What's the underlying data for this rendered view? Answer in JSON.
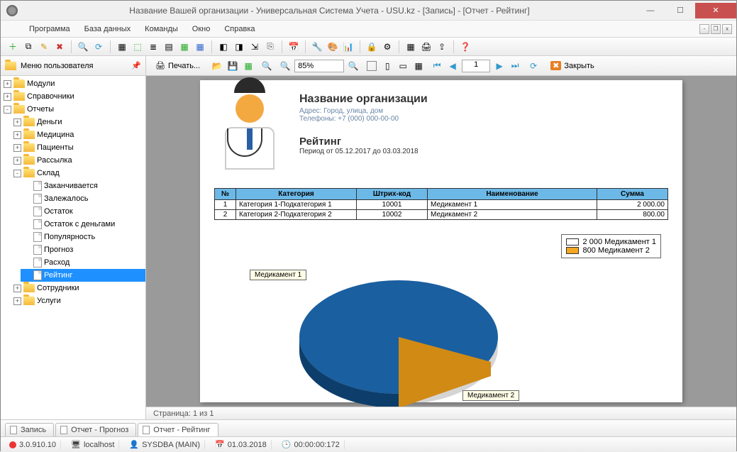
{
  "window": {
    "title": "Название Вашей организации - Универсальная Система Учета - USU.kz - [Запись] - [Отчет - Рейтинг]"
  },
  "menu": {
    "program": "Программа",
    "database": "База данных",
    "commands": "Команды",
    "window": "Окно",
    "help": "Справка"
  },
  "sidebar": {
    "header": "Меню пользователя",
    "items": {
      "modules": "Модули",
      "directories": "Справочники",
      "reports": "Отчеты",
      "money": "Деньги",
      "medicine": "Медицина",
      "patients": "Пациенты",
      "mailing": "Рассылка",
      "warehouse": "Склад",
      "ending": "Заканчивается",
      "stale": "Залежалось",
      "remainder": "Остаток",
      "remainder_money": "Остаток с деньгами",
      "popularity": "Популярность",
      "forecast": "Прогноз",
      "expense": "Расход",
      "rating": "Рейтинг",
      "employees": "Сотрудники",
      "services": "Услуги"
    }
  },
  "report_toolbar": {
    "print": "Печать...",
    "zoom": "85%",
    "page": "1",
    "close": "Закрыть"
  },
  "report": {
    "org_title": "Название организации",
    "address": "Адрес: Город, улица, дом",
    "phones": "Телефоны: +7 (000) 000-00-00",
    "heading": "Рейтинг",
    "period": "Период от 05.12.2017 до 03.03.2018",
    "columns": {
      "no": "№",
      "category": "Категория",
      "barcode": "Штрих-код",
      "name": "Наименование",
      "sum": "Сумма"
    },
    "rows": [
      {
        "no": "1",
        "category": "Категория 1-Подкатегория 1",
        "barcode": "10001",
        "name": "Медикамент 1",
        "sum": "2 000.00"
      },
      {
        "no": "2",
        "category": "Категория 2-Подкатегория 2",
        "barcode": "10002",
        "name": "Медикамент 2",
        "sum": "800.00"
      }
    ],
    "legend": [
      {
        "label": "2 000 Медикамент 1",
        "color": "#1a5fa0"
      },
      {
        "label": "800 Медикамент 2",
        "color": "#f5a623"
      }
    ],
    "callouts": {
      "m1": "Медикамент 1",
      "m2": "Медикамент 2"
    }
  },
  "chart_data": {
    "type": "pie",
    "title": "Рейтинг",
    "series": [
      {
        "name": "Медикамент 1",
        "value": 2000,
        "color": "#1a5fa0"
      },
      {
        "name": "Медикамент 2",
        "value": 800,
        "color": "#f5a623"
      }
    ]
  },
  "page_info": "Страница: 1 из 1",
  "tabs": {
    "t1": "Запись",
    "t2": "Отчет - Прогноз",
    "t3": "Отчет - Рейтинг"
  },
  "status": {
    "version": "3.0.910.10",
    "host": "localhost",
    "user": "SYSDBA (MAIN)",
    "date": "01.03.2018",
    "time": "00:00:00:172"
  }
}
